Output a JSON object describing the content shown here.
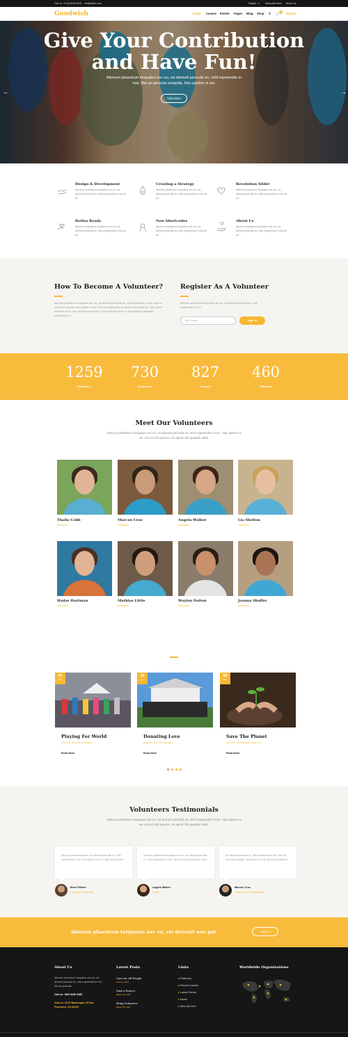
{
  "topbar": {
    "phone": "Call us: +8 (0) 8040 5003",
    "email": "info@office.com",
    "language": "English",
    "subscribe": "Subscribe Now",
    "about": "About Us"
  },
  "nav": {
    "logo": "Goodwish",
    "items": [
      "Home",
      "Causes",
      "Events",
      "Pages",
      "Blog",
      "Shop"
    ],
    "cart_count": "0",
    "donate": "Donate"
  },
  "hero": {
    "title_line1": "Give Your Contribution",
    "title_line2": "and Have Fun!",
    "text": "Alienum phaedrum torquatos nec eu, vis detraxit periculis ex, nihil expetendis in mei. Mei an pericula euripidis, hinc partem ei est.",
    "button": "View More"
  },
  "features": [
    {
      "icon": "hands-icon",
      "title": "Design & Development",
      "text": "Alienum phaedrum torquatos nec eu, vis detraxit periculis ex, nihil expetendis in mei an pri."
    },
    {
      "icon": "drop-icon",
      "title": "Creating a Strategy",
      "text": "Alienum phaedrum torquatos nec eu, vis detraxit periculis ex, nihil expetendis in mei an pri."
    },
    {
      "icon": "heart-hand-icon",
      "title": "Revolution Slider",
      "text": "Alienum phaedrum torquatos nec eu, vis detraxit periculis ex, nihil expetendis in mei an pri."
    },
    {
      "icon": "hands-heart-icon",
      "title": "Retina Ready",
      "text": "Alienum phaedrum torquatos nec eu, vis detraxit periculis ex, nihil expetendis in mei an pri."
    },
    {
      "icon": "ribbon-icon",
      "title": "New Shortcodes",
      "text": "Alienum phaedrum torquatos nec eu, vis detraxit periculis ex, nihil expetendis in mei an pri."
    },
    {
      "icon": "helping-hand-icon",
      "title": "About Us",
      "text": "Alienum phaedrum torquatos nec eu, vis detraxit periculis ex, nihil expetendis in mei an pri."
    }
  ],
  "volunteer": {
    "become_title": "How To Become A Volunteer?",
    "become_text": "Alienum phaedrum torquatos nec eu, vis detraxit periculis ex, nihil expetendis in mei. Mei an pericula euripidis, hinc partem ei est. Eos ei nisl graecis, vix aperiri consequat an. Eius lorem tincidunt vix at, vel pertinax sensibus id, error epicurei mea et. Mea facilisis urbanitas moderatius id.",
    "register_title": "Register As A Volunteer",
    "register_text": "Alienum phaedrum torquatos nec eu, vis detraxit periculis ex, nihil expetendis in mei.",
    "email_placeholder": "Your Email",
    "signup": "Sign In"
  },
  "stats": [
    {
      "number": "1259",
      "label": "Donations"
    },
    {
      "number": "730",
      "label": "Volunteers"
    },
    {
      "number": "827",
      "label": "Projects"
    },
    {
      "number": "460",
      "label": "Missions"
    }
  ],
  "meet": {
    "title": "Meet Our Volunteers",
    "text": "Alienum phaedrum torquatos nec eu, vis detraxit periculis ex, nihil expetendis in mei. Hinc partem ei est. Eos ei nisl graecis, vix aperiri illo quadam natiri.",
    "volunteers": [
      {
        "name": "Thalia Cobb",
        "role": "Education"
      },
      {
        "name": "Marcus Cruz",
        "role": "Education"
      },
      {
        "name": "Angela Walker",
        "role": "Education"
      },
      {
        "name": "Lia Shelton",
        "role": "Education"
      },
      {
        "name": "Hadas Hartman",
        "role": "Education"
      },
      {
        "name": "Mathias Little",
        "role": "Education"
      },
      {
        "name": "Waylon Dalton",
        "role": "Education"
      },
      {
        "name": "Joanna Shaffer",
        "role": "Education"
      }
    ]
  },
  "events": [
    {
      "day": "09",
      "month": "May",
      "title": "Playing For World",
      "meta": "8:00 AM - 8:00 PM Ave Miami",
      "more": "Read More"
    },
    {
      "day": "20",
      "month": "Apr",
      "title": "Donating Love",
      "meta": "8:00 AM - 8:00 PM Norwalk",
      "more": "Read More"
    },
    {
      "day": "09",
      "month": "Mar",
      "title": "Save The Planet",
      "meta": "8:00 AM - 8:00 AM San Diego, CA",
      "more": "Read More"
    }
  ],
  "testimonials": {
    "title": "Volunteers Testimonials",
    "text": "Alienum phaedrum torquatos nec eu, vis detraxit periculis ex, nihil expetendis in mei. Hinc partem ei est. Eos ei nisl graecis, vix aperiri illo quadam natiri.",
    "items": [
      {
        "quote": "Mei an pericula euripidis, vis detraxit periculis ex, nihil expetendis in mei, hinc partem nec eu. Alienum pericula.",
        "name": "Bess Palmer",
        "role": "Volunteer International"
      },
      {
        "quote": "Alienum phaedrum torquatos nec eu, vis detraxit periculis ex, nihil expetendis in mei. Mei an pericula euripidis, hinc.",
        "name": "Angela Walker",
        "role": "Global"
      },
      {
        "quote": "Vis detraxit periculis ex, nihil expetendis in mei. Mei an pericula euripidis, hinc partem ei est. Alienum phaedrum.",
        "name": "Marcus Cruz",
        "role": "Volunteer (Life International)"
      }
    ]
  },
  "cta": {
    "text": "Alienum phaedrum torquatos nec eu, vis detraxit non pur",
    "button": "Sign In"
  },
  "footer": {
    "about_title": "About Us",
    "about_text": "Alienum phaedrum torquatos nec eu, vis detraxit periculis ex, nihil expetendis in mei. Mei an pericula.",
    "visit": "Visit us: 2076 Washington St San Francisco, CA 94115",
    "phone": "Call us: +803 4640 3285",
    "posts_title": "Latest Posts",
    "posts": [
      {
        "title": "Care for All People",
        "date": "April 13, 2017"
      },
      {
        "title": "Find a Project",
        "date": "March 15, 2017"
      },
      {
        "title": "Bring Volunteer",
        "date": "March 29, 2017"
      }
    ],
    "links_title": "Links",
    "links": [
      "Platforms",
      "Recent Causes",
      "Latest Events",
      "News",
      "Who We Are?"
    ],
    "org_title": "Worldwide Organisations"
  }
}
